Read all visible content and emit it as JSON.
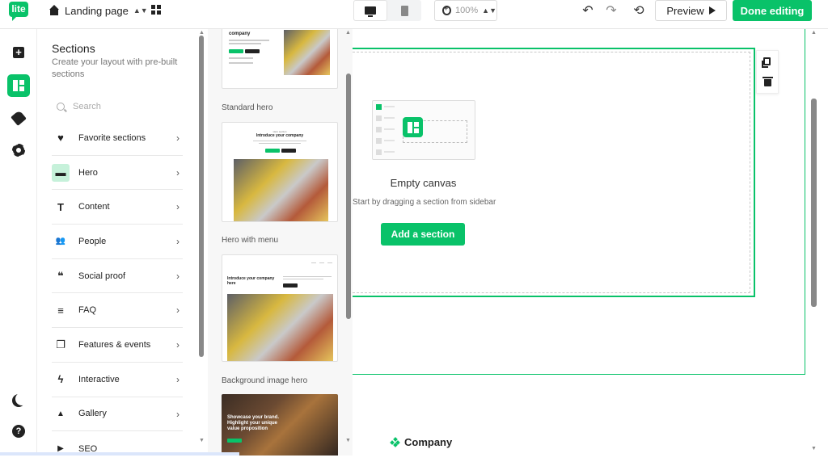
{
  "app": {
    "logo_text": "lite",
    "accent_color": "#09c269"
  },
  "topbar": {
    "page_name": "Landing page",
    "zoom": "100%",
    "preview_label": "Preview",
    "done_label": "Done editing",
    "icons": [
      "home-icon",
      "grid-icon",
      "desktop-icon",
      "tablet-icon",
      "zoom-icon",
      "undo-icon",
      "redo-icon",
      "history-icon",
      "play-icon"
    ]
  },
  "rail": {
    "icons": [
      "add-icon",
      "layout-icon",
      "brush-icon",
      "gear-icon",
      "moon-icon",
      "help-icon"
    ]
  },
  "sections_panel": {
    "title": "Sections",
    "subtitle": "Create your layout with pre-built sections",
    "search_placeholder": "Search",
    "categories": [
      {
        "label": "Favorite sections",
        "icon": "heart-icon",
        "glyph": "♥"
      },
      {
        "label": "Hero",
        "icon": "hero-icon",
        "glyph": "▬"
      },
      {
        "label": "Content",
        "icon": "text-icon",
        "glyph": "T"
      },
      {
        "label": "People",
        "icon": "people-icon",
        "glyph": "👥"
      },
      {
        "label": "Social proof",
        "icon": "quote-icon",
        "glyph": "❝"
      },
      {
        "label": "FAQ",
        "icon": "list-icon",
        "glyph": "≡"
      },
      {
        "label": "Features & events",
        "icon": "features-icon",
        "glyph": "❐"
      },
      {
        "label": "Interactive",
        "icon": "bolt-icon",
        "glyph": "ϟ"
      },
      {
        "label": "Gallery",
        "icon": "image-icon",
        "glyph": "▲"
      },
      {
        "label": "SEO",
        "icon": "seo-icon",
        "glyph": "▶"
      }
    ]
  },
  "templates": {
    "items": [
      {
        "label": "Standard hero"
      },
      {
        "label": "Hero with menu"
      },
      {
        "label": "Background image hero"
      }
    ],
    "thumb_texts": {
      "top_title": "company",
      "standard_small": "Hero section",
      "standard_title": "Introduce your company",
      "menu_title": "Introduce your company here",
      "bg_text": "Showcase your brand. Highlight your unique value proposition"
    }
  },
  "canvas": {
    "empty_title": "Empty canvas",
    "empty_subtitle": "Start by dragging a section from sidebar",
    "add_button": "Add a section",
    "footer_brand": "Company"
  }
}
